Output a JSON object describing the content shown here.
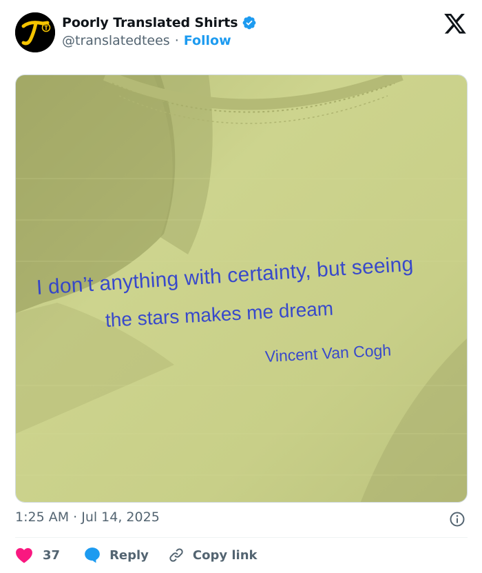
{
  "post": {
    "author": {
      "display_name": "Poorly Translated Shirts",
      "handle": "@translatedtees",
      "separator": "·",
      "follow_label": "Follow",
      "verified": true,
      "avatar_colors": {
        "background": "#000000",
        "mark": "#f5c400"
      }
    },
    "media": {
      "shirt_color": "#c9d08a",
      "print_color": "#2c3ed0",
      "lines": [
        "I don’t anything with certainty, but seeing",
        "the stars makes me dream",
        "Vincent Van Cogh"
      ]
    },
    "timestamp": "1:25 AM · Jul 14, 2025",
    "actions": {
      "like_count": "37",
      "reply_label": "Reply",
      "copy_link_label": "Copy link"
    },
    "colors": {
      "accent": "#1d9bf0",
      "like": "#f91880",
      "muted": "#536471"
    },
    "icons": [
      "x-logo-icon",
      "verified-badge-icon",
      "info-icon",
      "heart-icon",
      "reply-bubble-icon",
      "link-icon"
    ]
  }
}
